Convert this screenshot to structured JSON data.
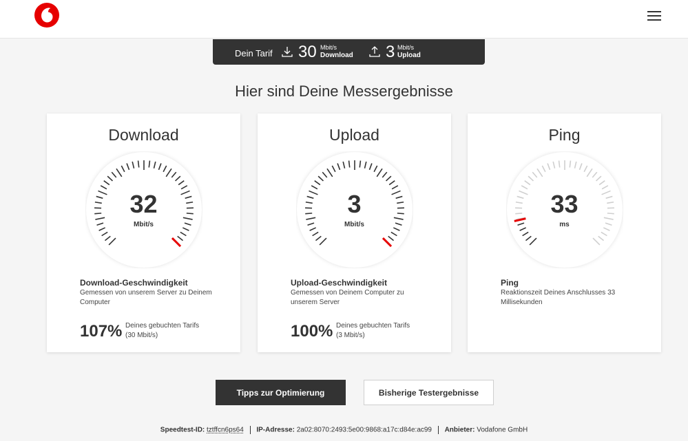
{
  "header": {
    "logo_icon": "vodafone-logo-icon",
    "menu_icon": "hamburger-menu-icon",
    "brand_color": "#e60000"
  },
  "tariff": {
    "label": "Dein Tarif",
    "download_value": "30",
    "download_unit": "Mbit/s",
    "download_label": "Download",
    "upload_value": "3",
    "upload_unit": "Mbit/s",
    "upload_label": "Upload"
  },
  "page_title": "Hier sind Deine Messergebnisse",
  "cards": [
    {
      "title": "Download",
      "value": "32",
      "unit": "Mbit/s",
      "gauge_fraction": 1.0,
      "detail_title": "Download-Geschwindigkeit",
      "detail_desc": "Gemessen von unserem Server zu Deinem Computer",
      "percent": "107%",
      "percent_label_1": "Deines gebuchten Tarifs",
      "percent_label_2": "(30 Mbit/s)"
    },
    {
      "title": "Upload",
      "value": "3",
      "unit": "Mbit/s",
      "gauge_fraction": 1.0,
      "detail_title": "Upload-Geschwindigkeit",
      "detail_desc": "Gemessen von Deinem Computer zu unserem Server",
      "percent": "100%",
      "percent_label_1": "Deines gebuchten Tarifs",
      "percent_label_2": "(3 Mbit/s)"
    },
    {
      "title": "Ping",
      "value": "33",
      "unit": "ms",
      "gauge_fraction": 0.12,
      "detail_title": "Ping",
      "detail_desc": "Reaktionszeit Deines Anschlusses 33 Millisekunden"
    }
  ],
  "buttons": {
    "tips": "Tipps zur Optimierung",
    "history": "Bisherige Testergebnisse"
  },
  "footer": {
    "speedtest_id_label": "Speedtest-ID:",
    "speedtest_id": "tztffcn6ps64",
    "ip_label": "IP-Adresse:",
    "ip": "2a02:8070:2493:5e00:9868:a17c:d84e:ac99",
    "provider_label": "Anbieter:",
    "provider": "Vodafone GmbH"
  }
}
